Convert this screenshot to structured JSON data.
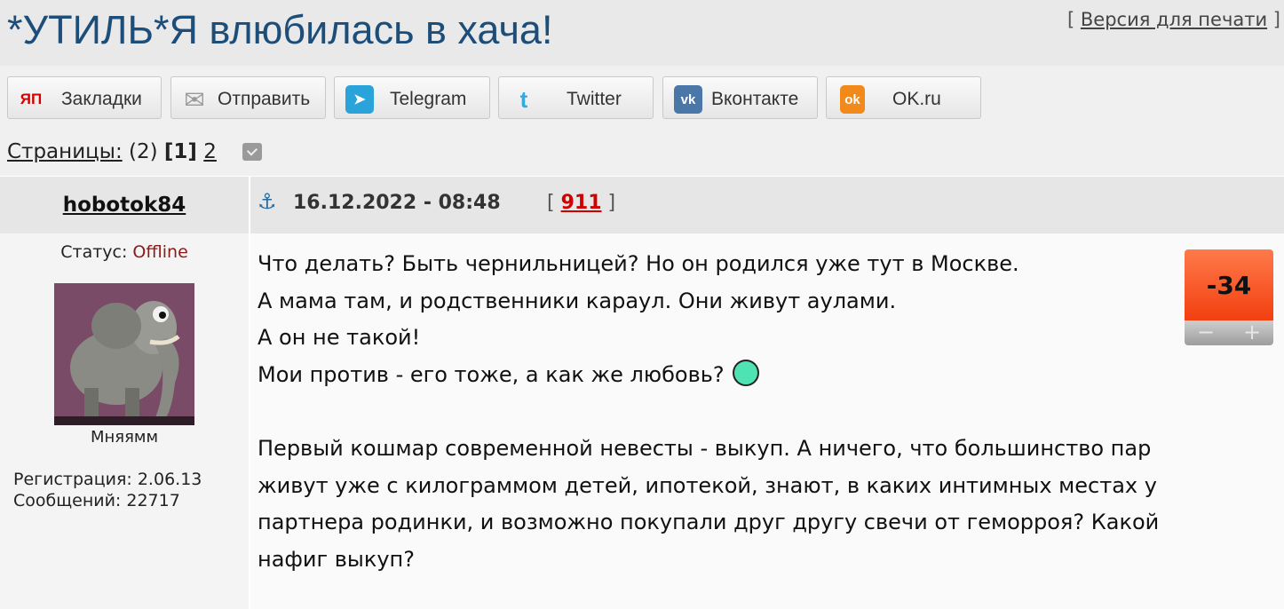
{
  "header": {
    "title": "*УТИЛЬ*Я влюбилась в хача!",
    "print_prefix": "[",
    "print_label": "Версия для печати",
    "print_suffix": "]"
  },
  "share": [
    {
      "id": "yap",
      "icon_text": "ЯП",
      "label": "Закладки",
      "color": "#ffffff",
      "text_color": "#d40000"
    },
    {
      "id": "mail",
      "icon_text": "✉",
      "label": "Отправить",
      "color": "#ffffff",
      "text_color": "#888888"
    },
    {
      "id": "telegram",
      "icon_text": "➤",
      "label": "Telegram",
      "color": "#2aa3db",
      "text_color": "#ffffff"
    },
    {
      "id": "twitter",
      "icon_text": "t",
      "label": "Twitter",
      "color": "#ffffff",
      "text_color": "#35a8e0"
    },
    {
      "id": "vk",
      "icon_text": "vk",
      "label": "Вконтакте",
      "color": "#4a76a8",
      "text_color": "#ffffff"
    },
    {
      "id": "ok",
      "icon_text": "ok",
      "label": "OK.ru",
      "color": "#f2891b",
      "text_color": "#ffffff"
    }
  ],
  "pagination": {
    "label": "Страницы:",
    "total": "(2)",
    "current": "[1]",
    "next": "2"
  },
  "post": {
    "author": "hobotok84",
    "anchor_icon": "anchor-icon",
    "date": "16.12.2022 - 08:48",
    "num_prefix": "[",
    "number": "911",
    "num_suffix": "]",
    "status_label": "Статус:",
    "status_value": "Offline",
    "status_color": "#8b1a1a",
    "nick": "Мняямм",
    "registration": "Регистрация: 2.06.13",
    "messages": "Сообщений: 22717",
    "rating": "-34",
    "rating_minus": "−",
    "rating_plus": "+",
    "lines": [
      "Что делать? Быть чернильницей? Но он родился уже тут в Москве.",
      "А мама там, и родственники караул. Они живут аулами.",
      "А он не такой!",
      "Мои против - его тоже, а как же любовь?"
    ],
    "paragraph2": "Первый кошмар современной невесты - выкуп. А ничего, что большинство пар живут уже с килограммом детей, ипотекой, знают, в каких интимных местах у партнера родинки, и возможно покупали друг другу свечи от геморроя? Какой нафиг выкуп?"
  }
}
